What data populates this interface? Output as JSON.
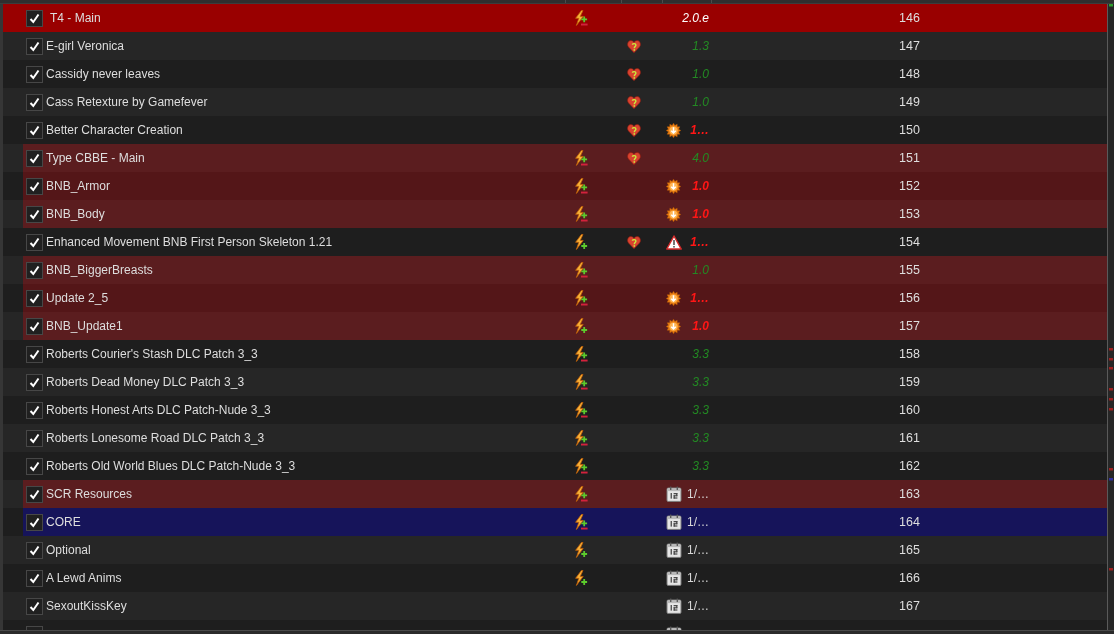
{
  "mod_list": {
    "rows": [
      {
        "checked": true,
        "name": "T4 - Main",
        "selected": true,
        "icons": [
          {
            "kind": "mixed"
          }
        ],
        "version": "2.0.e",
        "priority": "146"
      },
      {
        "checked": true,
        "name": "E-girl Veronica",
        "selected": false,
        "icons": [
          {
            "kind": "endorse"
          }
        ],
        "version": "1.3",
        "priority": "147"
      },
      {
        "checked": true,
        "name": "Cassidy never leaves",
        "selected": false,
        "icons": [
          {
            "kind": "endorse"
          }
        ],
        "version": "1.0",
        "priority": "148"
      },
      {
        "checked": true,
        "name": "Cass Retexture by Gamefever",
        "selected": false,
        "icons": [
          {
            "kind": "endorse"
          }
        ],
        "version": "1.0",
        "priority": "149"
      },
      {
        "checked": true,
        "name": "Better Character Creation",
        "selected": false,
        "icons": [
          {
            "kind": "endorse"
          },
          {
            "kind": "update"
          }
        ],
        "version": "1…",
        "priority": "150"
      },
      {
        "checked": true,
        "name": "Type CBBE - Main",
        "selected": false,
        "color": "#5b1d1f",
        "icons": [
          {
            "kind": "mixed"
          },
          {
            "kind": "endorse"
          }
        ],
        "version": "4.0",
        "priority": "151"
      },
      {
        "checked": true,
        "name": "BNB_Armor",
        "selected": false,
        "color": "#541618",
        "icons": [
          {
            "kind": "mixed"
          },
          {
            "kind": "update"
          }
        ],
        "version": "1.0",
        "priority": "152"
      },
      {
        "checked": true,
        "name": "BNB_Body",
        "selected": false,
        "color": "#5b1d1f",
        "icons": [
          {
            "kind": "mixed"
          },
          {
            "kind": "update"
          }
        ],
        "version": "1.0",
        "priority": "153"
      },
      {
        "checked": true,
        "name": "Enhanced Movement BNB First Person Skeleton 1.21",
        "selected": false,
        "icons": [
          {
            "kind": "overwrite"
          },
          {
            "kind": "endorse"
          },
          {
            "kind": "warning"
          }
        ],
        "version": "1…",
        "priority": "154"
      },
      {
        "checked": true,
        "name": "BNB_BiggerBreasts",
        "selected": false,
        "color": "#5b1d1f",
        "icons": [
          {
            "kind": "mixed"
          }
        ],
        "version": "1.0",
        "priority": "155"
      },
      {
        "checked": true,
        "name": "Update 2_5",
        "selected": false,
        "color": "#541618",
        "icons": [
          {
            "kind": "mixed"
          },
          {
            "kind": "update"
          }
        ],
        "version": "1…",
        "priority": "156"
      },
      {
        "checked": true,
        "name": "BNB_Update1",
        "selected": false,
        "color": "#5b1d1f",
        "icons": [
          {
            "kind": "overwrite"
          },
          {
            "kind": "update"
          }
        ],
        "version": "1.0",
        "priority": "157"
      },
      {
        "checked": true,
        "name": "Roberts Courier's Stash DLC Patch 3_3",
        "selected": false,
        "icons": [
          {
            "kind": "mixed"
          }
        ],
        "version": "3.3",
        "priority": "158"
      },
      {
        "checked": true,
        "name": "Roberts Dead Money DLC Patch 3_3",
        "selected": false,
        "icons": [
          {
            "kind": "mixed"
          }
        ],
        "version": "3.3",
        "priority": "159"
      },
      {
        "checked": true,
        "name": "Roberts Honest Arts DLC Patch-Nude 3_3",
        "selected": false,
        "icons": [
          {
            "kind": "mixed"
          }
        ],
        "version": "3.3",
        "priority": "160"
      },
      {
        "checked": true,
        "name": "Roberts Lonesome Road DLC Patch 3_3",
        "selected": false,
        "icons": [
          {
            "kind": "mixed"
          }
        ],
        "version": "3.3",
        "priority": "161"
      },
      {
        "checked": true,
        "name": "Roberts Old World Blues DLC Patch-Nude 3_3",
        "selected": false,
        "icons": [
          {
            "kind": "mixed"
          }
        ],
        "version": "3.3",
        "priority": "162"
      },
      {
        "checked": true,
        "name": "SCR Resources",
        "selected": false,
        "color": "#5b1d1f",
        "icons": [
          {
            "kind": "mixed"
          },
          {
            "kind": "date"
          }
        ],
        "version": "1/…",
        "priority": "163"
      },
      {
        "checked": true,
        "name": "CORE",
        "selected": false,
        "color": "#16145a",
        "icons": [
          {
            "kind": "mixed"
          },
          {
            "kind": "date"
          }
        ],
        "version": "1/…",
        "priority": "164"
      },
      {
        "checked": true,
        "name": "Optional",
        "selected": false,
        "icons": [
          {
            "kind": "overwrite"
          },
          {
            "kind": "date"
          }
        ],
        "version": "1/…",
        "priority": "165"
      },
      {
        "checked": true,
        "name": "A Lewd Anims",
        "selected": false,
        "icons": [
          {
            "kind": "overwrite"
          },
          {
            "kind": "date"
          }
        ],
        "version": "1/…",
        "priority": "166"
      },
      {
        "checked": true,
        "name": "SexoutKissKey",
        "selected": false,
        "icons": [
          {
            "kind": "date"
          }
        ],
        "version": "1/…",
        "priority": "167"
      },
      {
        "selected": false,
        "icons": [
          {
            "kind": "date"
          }
        ]
      }
    ]
  }
}
